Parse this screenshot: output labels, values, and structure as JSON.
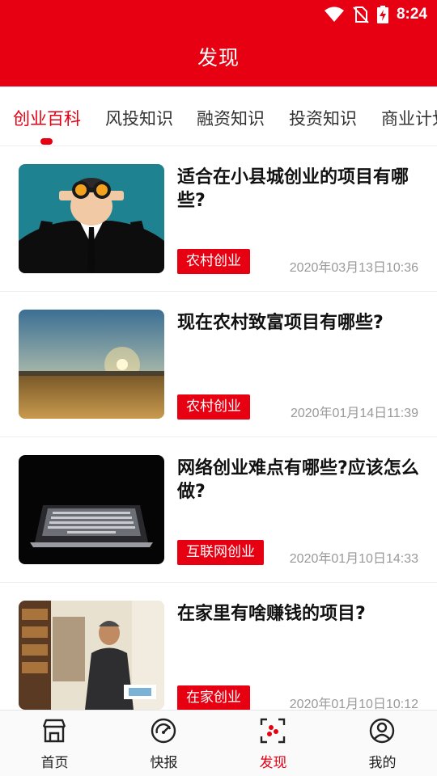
{
  "status": {
    "time": "8:24"
  },
  "header": {
    "title": "发现"
  },
  "tabs": [
    {
      "label": "创业百科",
      "active": true
    },
    {
      "label": "风投知识",
      "active": false
    },
    {
      "label": "融资知识",
      "active": false
    },
    {
      "label": "投资知识",
      "active": false
    },
    {
      "label": "商业计划",
      "active": false
    }
  ],
  "articles": [
    {
      "title": "适合在小县城创业的项目有哪些?",
      "tag": "农村创业",
      "date": "2020年03月13日10:36",
      "image": "man-with-binoculars"
    },
    {
      "title": "现在农村致富项目有哪些?",
      "tag": "农村创业",
      "date": "2020年01月14日11:39",
      "image": "sunset-field"
    },
    {
      "title": "网络创业难点有哪些?应该怎么做?",
      "tag": "互联网创业",
      "date": "2020年01月10日14:33",
      "image": "laptop-in-dark"
    },
    {
      "title": "在家里有啥赚钱的项目?",
      "tag": "在家创业",
      "date": "2020年01月10日10:12",
      "image": "man-in-bookstore"
    }
  ],
  "bottom_nav": [
    {
      "label": "首页",
      "icon": "store-icon",
      "active": false
    },
    {
      "label": "快报",
      "icon": "gauge-icon",
      "active": false
    },
    {
      "label": "发现",
      "icon": "scan-icon",
      "active": true
    },
    {
      "label": "我的",
      "icon": "user-icon",
      "active": false
    }
  ],
  "colors": {
    "accent": "#e60012",
    "text": "#111111",
    "muted": "#999999"
  }
}
